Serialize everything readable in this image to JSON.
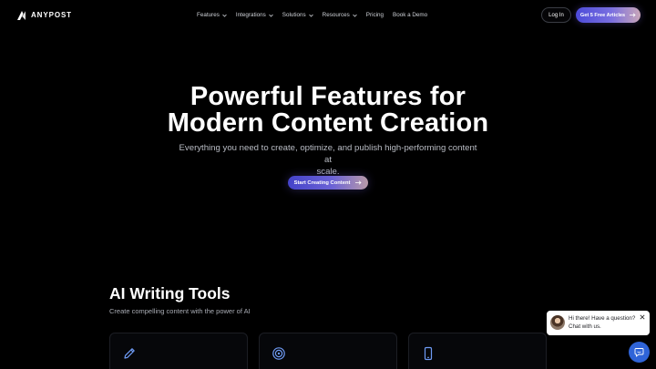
{
  "brand": {
    "name": "ANYPOST",
    "icon": "anypost-logo-icon"
  },
  "nav": {
    "items": [
      {
        "label": "Features",
        "has_dropdown": true
      },
      {
        "label": "Integrations",
        "has_dropdown": true
      },
      {
        "label": "Solutions",
        "has_dropdown": true
      },
      {
        "label": "Resources",
        "has_dropdown": true
      },
      {
        "label": "Pricing",
        "has_dropdown": false
      },
      {
        "label": "Book a Demo",
        "has_dropdown": false
      }
    ],
    "login_label": "Log In",
    "cta_label": "Get 5 Free Articles"
  },
  "hero": {
    "title_line1": "Powerful Features for",
    "title_line2": "Modern Content Creation",
    "subtitle_line1": "Everything you need to create, optimize, and publish high-performing content at",
    "subtitle_line2": "scale.",
    "cta_label": "Start Creating Content"
  },
  "section": {
    "title": "AI Writing Tools",
    "subtitle": "Create compelling content with the power of AI",
    "cards": [
      {
        "icon": "pencil-icon"
      },
      {
        "icon": "target-icon"
      },
      {
        "icon": "mobile-icon"
      }
    ]
  },
  "chat": {
    "line1": "Hi there! Have a question?",
    "line2": "Chat with us.",
    "icons": [
      "agent-avatar",
      "close-icon",
      "chat-launcher-icon"
    ]
  },
  "colors": {
    "background": "#000000",
    "accent_start": "#4c4bd9",
    "accent_end": "#c9a6b8",
    "chat_blue": "#2f64d8",
    "icon_blue": "#6f9cf7"
  }
}
